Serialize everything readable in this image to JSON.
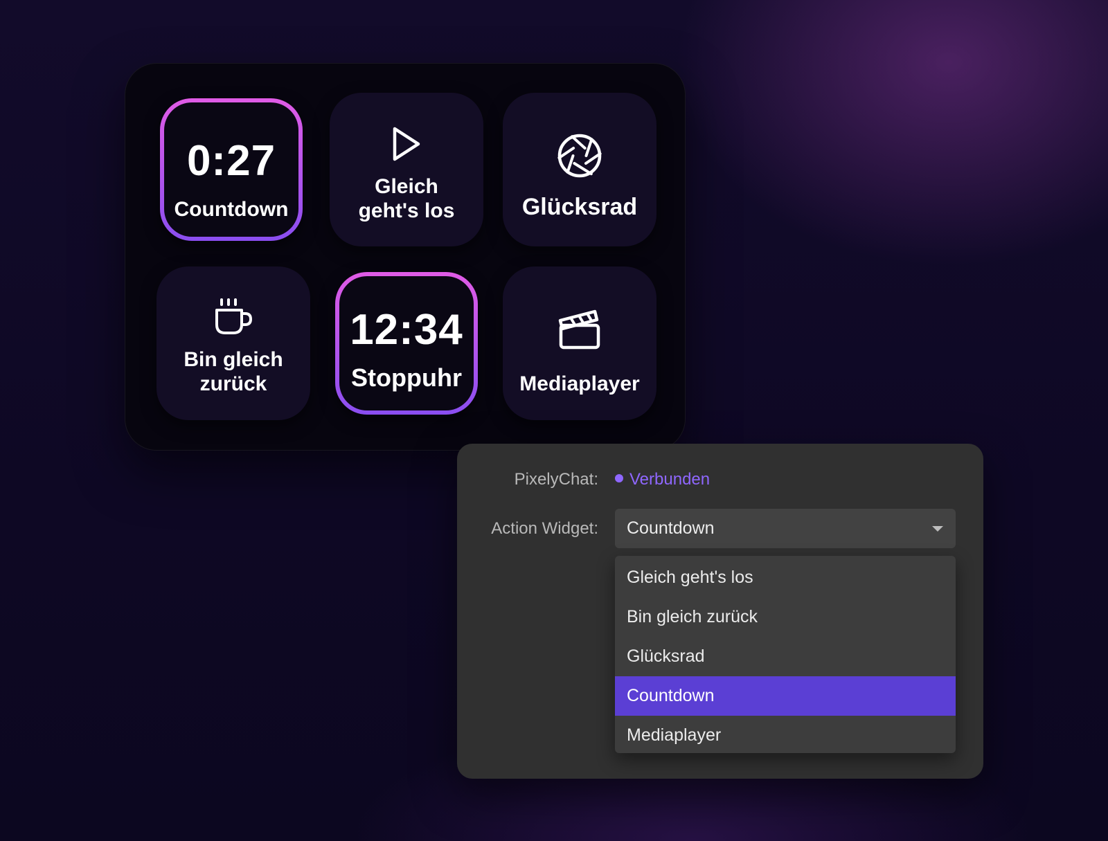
{
  "deck": {
    "tiles": [
      {
        "value": "0:27",
        "label": "Countdown",
        "active": true
      },
      {
        "icon": "play-icon",
        "label_line1": "Gleich",
        "label_line2": "geht's los",
        "active": false
      },
      {
        "icon": "aperture-icon",
        "label": "Glücksrad",
        "active": false
      },
      {
        "icon": "coffee-cup-icon",
        "label_line1": "Bin gleich",
        "label_line2": "zurück",
        "active": false
      },
      {
        "value": "12:34",
        "label": "Stoppuhr",
        "active": true
      },
      {
        "icon": "clapperboard-icon",
        "label": "Mediaplayer",
        "active": false
      }
    ],
    "colors": {
      "active_border_top": "#e05be6",
      "active_border_bottom": "#8a4ef0"
    }
  },
  "settings": {
    "chat_label": "PixelyChat:",
    "chat_status": "Verbunden",
    "widget_label": "Action Widget:",
    "widget_value": "Countdown",
    "options": [
      "Gleich geht's los",
      "Bin gleich zurück",
      "Glücksrad",
      "Countdown",
      "Mediaplayer"
    ],
    "selected_option": "Countdown",
    "colors": {
      "status": "#8f67ff",
      "selection": "#5b3fd4"
    }
  }
}
